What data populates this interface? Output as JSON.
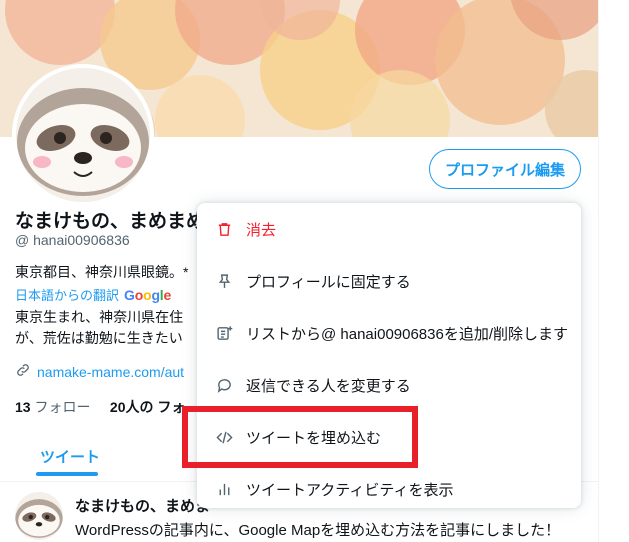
{
  "profile": {
    "edit_button": "プロファイル編集",
    "name": "なまけもの、まめまめ",
    "handle": "@ hanai00906836",
    "bio_original": "東京都目、神奈川県眼鏡。*",
    "translation_label": "日本語からの翻訳",
    "translation_brand": "Google",
    "bio_translated_1": "東京生まれ、神奈川県在住",
    "bio_translated_2": "が、荒佐は勤勉に生きたい",
    "link_text": "namake-mame.com/aut",
    "following_count": "13",
    "following_label": "フォロー",
    "followers_text": "20人の フォ"
  },
  "tabs": {
    "tweets": "ツイート"
  },
  "tweet": {
    "author": "なまけもの、まめま",
    "text": "WordPressの記事内に、Google Mapを埋め込む方法を記事にしました！"
  },
  "menu": {
    "items": [
      {
        "label": "消去",
        "icon": "trash-icon"
      },
      {
        "label": "プロフィールに固定する",
        "icon": "pin-icon"
      },
      {
        "label": "リストから@ hanai00906836を追加/削除します",
        "icon": "list-add-icon"
      },
      {
        "label": "返信できる人を変更する",
        "icon": "speech-bubble-icon"
      },
      {
        "label": "ツイートを埋め込む",
        "icon": "code-icon"
      },
      {
        "label": "ツイートアクティビティを表示",
        "icon": "bar-chart-icon"
      }
    ]
  },
  "colors": {
    "accent": "#1d9bf0",
    "danger": "#f4212e",
    "highlight_box": "#e8202a"
  }
}
